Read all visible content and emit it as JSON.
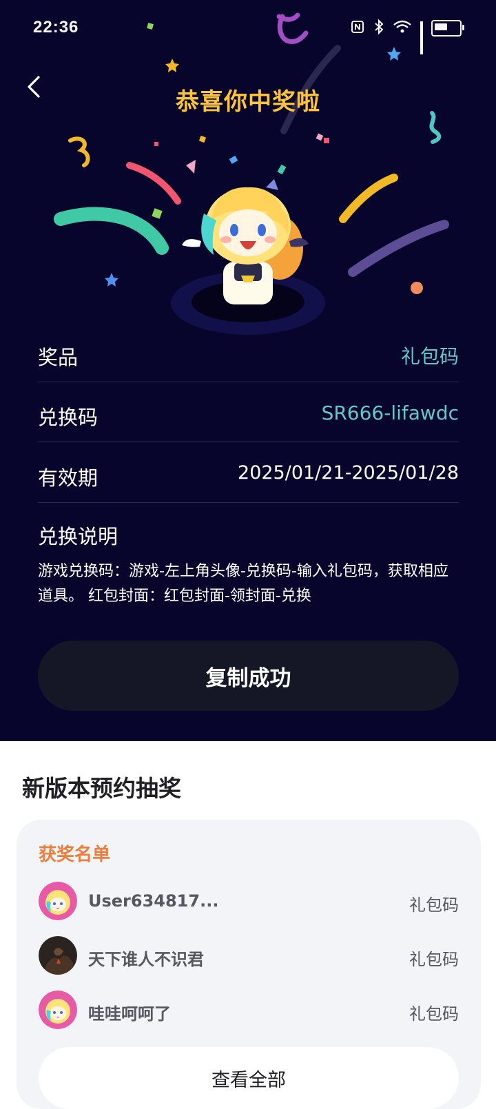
{
  "status_bar": {
    "time": "22:36"
  },
  "hero": {
    "title": "恭喜你中奖啦",
    "back_icon": "chevron-left-icon",
    "colors": {
      "background": "#07052b",
      "title": "#ffc53a",
      "accent": "#62c9c9"
    }
  },
  "prize_info": {
    "prize_label": "奖品",
    "prize_value": "礼包码",
    "code_label": "兑换码",
    "code_value": "SR666-lifawdc",
    "valid_label": "有效期",
    "valid_value": "2025/01/21-2025/01/28",
    "desc_title": "兑换说明",
    "desc_text": "游戏兑换码：游戏-左上角头像-兑换码-输入礼包码，获取相应道具。 红包封面：红包封面-领封面-兑换"
  },
  "copy_button": {
    "label": "复制成功"
  },
  "lottery": {
    "section_title": "新版本预约抽奖",
    "winners_heading": "获奖名单",
    "winners": [
      {
        "name": "User634817...",
        "prize": "礼包码",
        "avatar": "mascot-avatar"
      },
      {
        "name": "天下谁人不识君",
        "prize": "礼包码",
        "avatar": "dark-photo-avatar"
      },
      {
        "name": "哇哇呵呵了",
        "prize": "礼包码",
        "avatar": "mascot-avatar"
      }
    ],
    "view_all_label": "查看全部",
    "heading_color": "#ef7d3b"
  }
}
